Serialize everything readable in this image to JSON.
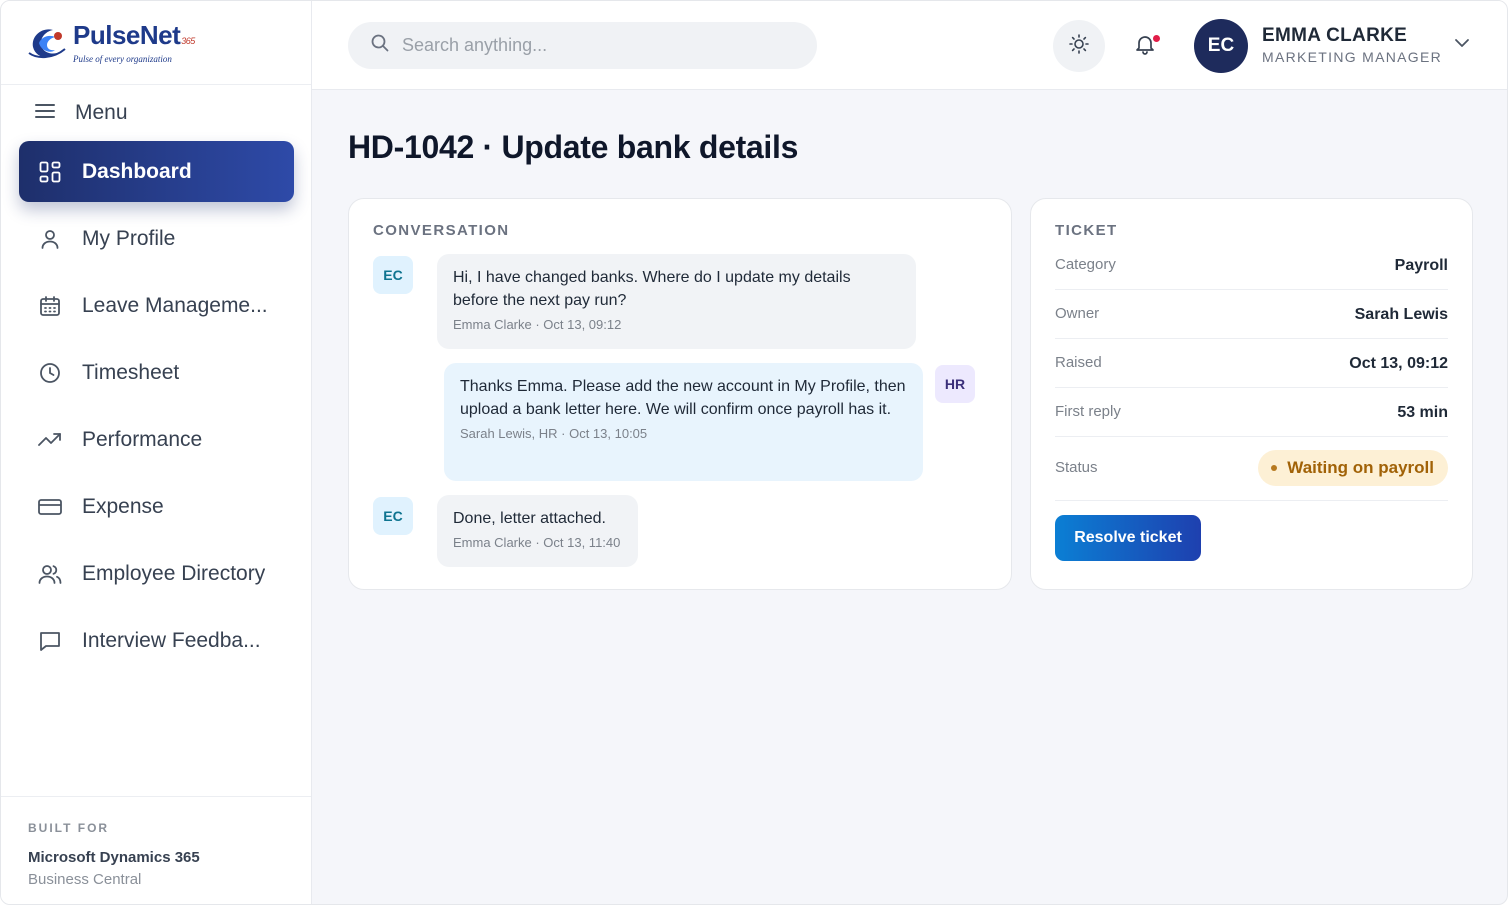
{
  "app": {
    "logo_name": "PulseNet",
    "logo_suffix": "365",
    "logo_tagline": "Pulse of every organization"
  },
  "sidebar": {
    "menu_label": "Menu",
    "items": [
      {
        "label": "Dashboard",
        "icon": "dashboard-grid-icon",
        "active": true
      },
      {
        "label": "My Profile",
        "icon": "user-icon"
      },
      {
        "label": "Leave Manageme...",
        "icon": "calendar-icon"
      },
      {
        "label": "Timesheet",
        "icon": "clock-icon"
      },
      {
        "label": "Performance",
        "icon": "trending-up-icon"
      },
      {
        "label": "Expense",
        "icon": "credit-card-icon"
      },
      {
        "label": "Employee Directory",
        "icon": "users-icon"
      },
      {
        "label": "Interview Feedba...",
        "icon": "message-square-icon"
      }
    ],
    "footer": {
      "label": "BUILT FOR",
      "title": "Microsoft Dynamics 365",
      "subtitle": "Business Central"
    }
  },
  "topbar": {
    "search_placeholder": "Search anything...",
    "user": {
      "initials": "EC",
      "name": "EMMA CLARKE",
      "role": "MARKETING MANAGER"
    }
  },
  "page": {
    "title": "HD-1042 · Update bank details"
  },
  "conversation": {
    "label": "CONVERSATION",
    "messages": [
      {
        "avatar": "EC",
        "body": "Hi, I have changed banks. Where do I update my details before the next pay run?",
        "meta": "Emma Clarke · Oct 13, 09:12"
      },
      {
        "avatar": "HR",
        "body": "Thanks Emma. Please add the new account in My Profile, then upload a bank letter here. We will confirm once payroll has it.",
        "meta": "Sarah Lewis, HR · Oct 13, 10:05"
      },
      {
        "avatar": "EC",
        "body": "Done, letter attached.",
        "meta": "Emma Clarke · Oct 13, 11:40"
      }
    ]
  },
  "ticket": {
    "label": "TICKET",
    "rows": [
      {
        "key": "Category",
        "value": "Payroll"
      },
      {
        "key": "Owner",
        "value": "Sarah Lewis"
      },
      {
        "key": "Raised",
        "value": "Oct 13, 09:12"
      },
      {
        "key": "First reply",
        "value": "53 min"
      }
    ],
    "status_key": "Status",
    "status_value": "Waiting on payroll",
    "resolve_label": "Resolve ticket"
  },
  "colors": {
    "active_nav": "#1e2f6b",
    "accent": "#1e40af",
    "status_bg": "#fdf0d5",
    "status_text": "#a16207"
  }
}
